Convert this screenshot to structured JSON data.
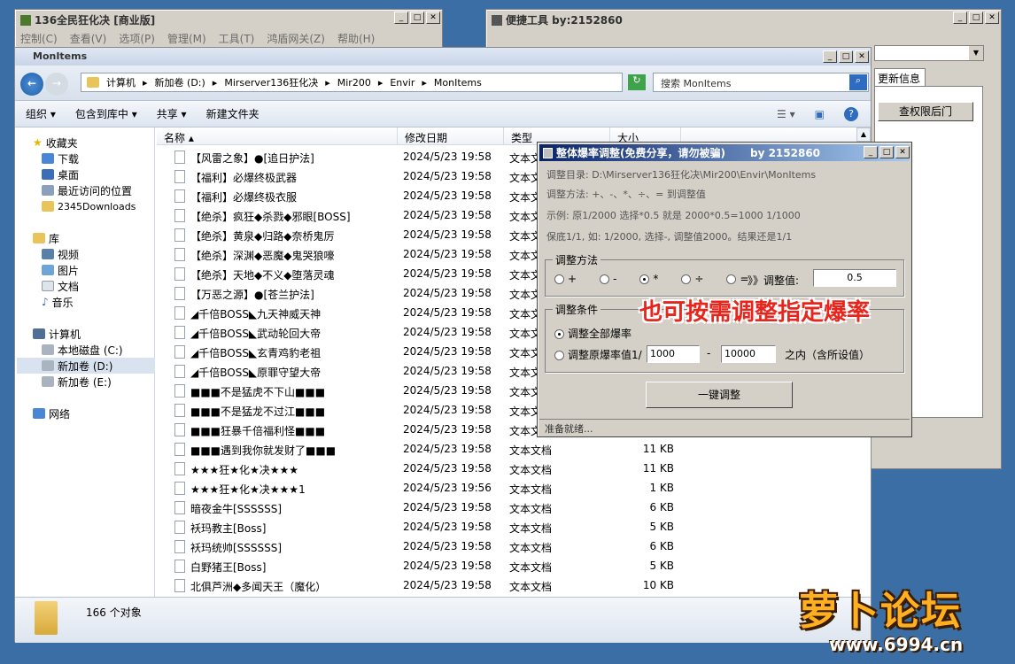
{
  "win1": {
    "title": "136全民狂化决 [商业版]",
    "menus": [
      "控制(C)",
      "查看(V)",
      "选项(P)",
      "管理(M)",
      "工具(T)",
      "鸿盾网关(Z)",
      "帮助(H)"
    ]
  },
  "win2": {
    "title": "便捷工具 by:2152860",
    "tab": "更新信息",
    "button": "查权限后门"
  },
  "explorer": {
    "title": "MonItems",
    "breadcrumb": [
      "计算机",
      "新加卷 (D:)",
      "Mirserver136狂化决",
      "Mir200",
      "Envir",
      "MonItems"
    ],
    "search_placeholder": "搜索 MonItems",
    "toolbar": [
      "组织",
      "包含到库中",
      "共享",
      "新建文件夹"
    ],
    "nav": {
      "favorites": "收藏夹",
      "fav_items": [
        "下载",
        "桌面",
        "最近访问的位置",
        "2345Downloads"
      ],
      "library": "库",
      "lib_items": [
        "视频",
        "图片",
        "文档",
        "音乐"
      ],
      "computer": "计算机",
      "comp_items": [
        "本地磁盘 (C:)",
        "新加卷 (D:)",
        "新加卷 (E:)"
      ],
      "network": "网络"
    },
    "columns": [
      "名称",
      "修改日期",
      "类型",
      "大小"
    ],
    "files": [
      {
        "name": "【风雷之象】●[追日护法]",
        "date": "2024/5/23 19:58",
        "type": "文本文",
        "size": ""
      },
      {
        "name": "【福利】必爆终极武器",
        "date": "2024/5/23 19:58",
        "type": "文本文",
        "size": ""
      },
      {
        "name": "【福利】必爆终极衣服",
        "date": "2024/5/23 19:58",
        "type": "文本文",
        "size": ""
      },
      {
        "name": "【绝杀】疯狂◆杀戮◆邪眼[BOSS]",
        "date": "2024/5/23 19:58",
        "type": "文本文",
        "size": ""
      },
      {
        "name": "【绝杀】黄泉◆归路◆奈桥鬼厉",
        "date": "2024/5/23 19:58",
        "type": "文本文",
        "size": ""
      },
      {
        "name": "【绝杀】深渊◆恶魔◆鬼哭狼嚎",
        "date": "2024/5/23 19:58",
        "type": "文本文",
        "size": ""
      },
      {
        "name": "【绝杀】天地◆不义◆堕落灵魂",
        "date": "2024/5/23 19:58",
        "type": "文本文",
        "size": ""
      },
      {
        "name": "【万恶之源】●[苍兰护法]",
        "date": "2024/5/23 19:58",
        "type": "文本文",
        "size": ""
      },
      {
        "name": "◢千倍BOSS◣九天神威天神",
        "date": "2024/5/23 19:58",
        "type": "文本文",
        "size": ""
      },
      {
        "name": "◢千倍BOSS◣武动轮回大帝",
        "date": "2024/5/23 19:58",
        "type": "文本文",
        "size": ""
      },
      {
        "name": "◢千倍BOSS◣玄青鸡豹老祖",
        "date": "2024/5/23 19:58",
        "type": "文本文",
        "size": ""
      },
      {
        "name": "◢千倍BOSS◣原罪守望大帝",
        "date": "2024/5/23 19:58",
        "type": "文本文",
        "size": ""
      },
      {
        "name": "■■■不是猛虎不下山■■■",
        "date": "2024/5/23 19:58",
        "type": "文本文",
        "size": ""
      },
      {
        "name": "■■■不是猛龙不过江■■■",
        "date": "2024/5/23 19:58",
        "type": "文本文",
        "size": ""
      },
      {
        "name": "■■■狂暴千倍福利怪■■■",
        "date": "2024/5/23 19:58",
        "type": "文本文",
        "size": ""
      },
      {
        "name": "■■■遇到我你就发财了■■■",
        "date": "2024/5/23 19:58",
        "type": "文本文档",
        "size": "11 KB"
      },
      {
        "name": "★★★狂★化★决★★★",
        "date": "2024/5/23 19:58",
        "type": "文本文档",
        "size": "11 KB"
      },
      {
        "name": "★★★狂★化★决★★★1",
        "date": "2024/5/23 19:56",
        "type": "文本文档",
        "size": "1 KB"
      },
      {
        "name": "暗夜金牛[SSSSSS]",
        "date": "2024/5/23 19:58",
        "type": "文本文档",
        "size": "6 KB"
      },
      {
        "name": "袄玛教主[Boss]",
        "date": "2024/5/23 19:58",
        "type": "文本文档",
        "size": "5 KB"
      },
      {
        "name": "袄玛统帅[SSSSSS]",
        "date": "2024/5/23 19:58",
        "type": "文本文档",
        "size": "6 KB"
      },
      {
        "name": "白野猪王[Boss]",
        "date": "2024/5/23 19:58",
        "type": "文本文档",
        "size": "5 KB"
      },
      {
        "name": "北俱芦洲◆多闻天王（魔化）",
        "date": "2024/5/23 19:58",
        "type": "文本文档",
        "size": "10 KB"
      }
    ],
    "status": "166 个对象"
  },
  "dialog": {
    "title": "整体爆率调整(免费分享，请勿被骗)",
    "author": "by 2152860",
    "info": [
      "调整目录: D:\\Mirserver136狂化决\\Mir200\\Envir\\MonItems",
      "调整方法: +、-、*、÷、=   到调整值",
      "示例: 原1/2000 选择*0.5 就是 2000*0.5=1000  1/1000",
      "保底1/1, 如: 1/2000, 选择-, 调整值2000。结果还是1/1"
    ],
    "method_group": "调整方法",
    "ops": [
      "+",
      "-",
      "*",
      "÷",
      "="
    ],
    "adjust_label": "》》调整值:",
    "adjust_value": "0.5",
    "cond_group": "调整条件",
    "cond_all": "调整全部爆率",
    "cond_range": "调整原爆率值1/",
    "range_min": "1000",
    "range_max": "10000",
    "range_dash": "-",
    "range_suffix": "之内（含所设值）",
    "button": "一键调整",
    "status": "准备就绪..."
  },
  "overlay_text": "也可按需调整指定爆率",
  "watermark": {
    "line1": "萝卜论坛",
    "line2": "www.6994.cn"
  },
  "colors": {
    "desktop": "#3b6ea5",
    "overlay": "#e8251c"
  }
}
